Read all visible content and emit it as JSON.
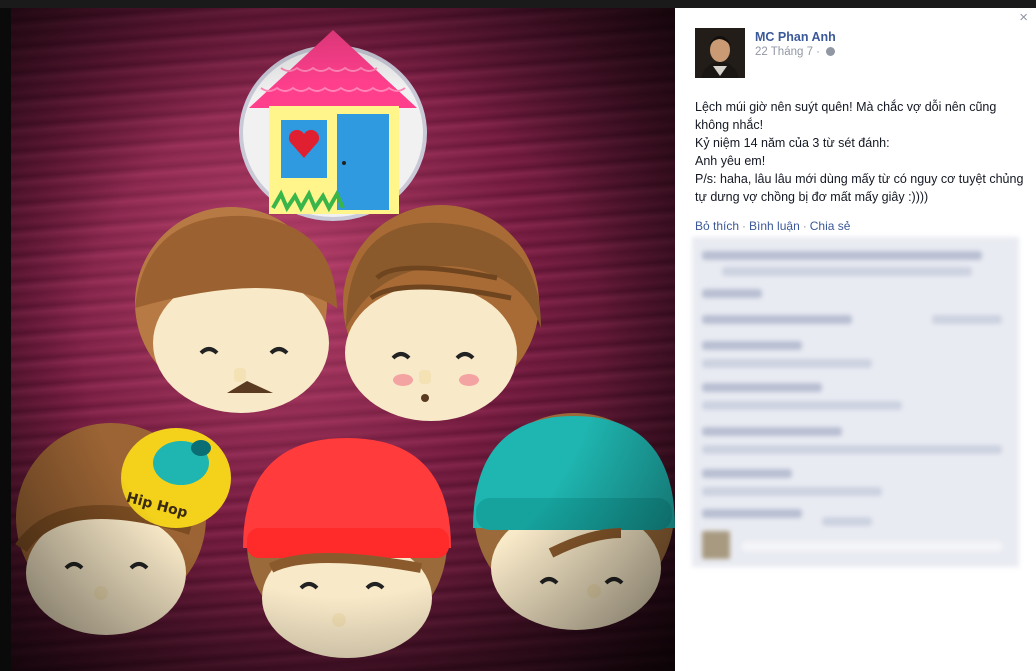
{
  "panel": {
    "author_name": "MC Phan Anh",
    "post_date": "22 Tháng 7 ·",
    "close_symbol": "×",
    "post_lines": [
      "Lệch múi giờ nên suýt quên! Mà chắc vợ dỗi nên cũng không nhắc!",
      "Kỷ niệm 14 năm của 3 từ sét đánh:",
      "Anh yêu em!",
      "P/s: haha, lâu lâu mới dùng mấy từ có nguy cơ tuyệt chủng tự dưng vợ chồng bị đơ mất mấy giây :))))"
    ],
    "actions": {
      "like": "Bỏ thích",
      "comment": "Bình luận",
      "share": "Chia sẻ"
    }
  },
  "photo": {
    "cap_text": "Hip Hop",
    "colors": {
      "wood": "#6b1c3d",
      "roof": "#ff3f8c",
      "door": "#2f9ae0",
      "heart": "#e02030",
      "red_hat": "#ff3b3b",
      "teal_hat": "#1fb5b0",
      "yellow_cap": "#f4d21c",
      "face": "#f8e9c8",
      "hair": "#8a5a2c"
    }
  }
}
